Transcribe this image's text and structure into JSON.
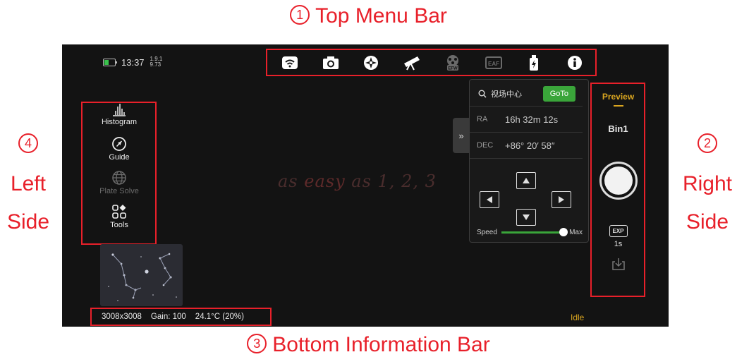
{
  "annotations": {
    "top": {
      "num": "1",
      "text": "Top Menu Bar"
    },
    "bottom": {
      "num": "3",
      "text": "Bottom Information Bar"
    },
    "left": {
      "num": "4",
      "line1": "Left",
      "line2": "Side"
    },
    "right": {
      "num": "2",
      "line1": "Right",
      "line2": "Side"
    },
    "color": "#e8202a"
  },
  "status": {
    "time": "13:37",
    "version_top": "1.9.1",
    "version_bottom": "9.73"
  },
  "topbar": {
    "icons": [
      "wifi-icon",
      "camera-icon",
      "focuser-icon",
      "telescope-icon",
      "efw-icon",
      "eaf-icon",
      "power-icon",
      "info-icon"
    ],
    "efw_label": "EFW",
    "eaf_label": "EAF"
  },
  "leftbar": {
    "items": [
      {
        "label": "Histogram",
        "icon": "histogram-icon"
      },
      {
        "label": "Guide",
        "icon": "guide-icon"
      },
      {
        "label": "Plate Solve",
        "icon": "globe-icon",
        "disabled": true
      },
      {
        "label": "Tools",
        "icon": "tools-icon"
      }
    ]
  },
  "watermark": {
    "part1": "as ",
    "part2": "easy",
    "part3": " as 1, 2, 3"
  },
  "goto_panel": {
    "search_text": "视场中心",
    "goto_label": "GoTo",
    "ra_label": "RA",
    "ra_value": "16h 32m 12s",
    "dec_label": "DEC",
    "dec_value": "+86° 20′ 58″",
    "speed_label": "Speed",
    "speed_max_label": "Max",
    "speed_value": 1.0,
    "collapse_icon": "»"
  },
  "right_panel": {
    "preview_label": "Preview",
    "bin_label": "Bin1",
    "exp_label": "EXP",
    "exp_value": "1s"
  },
  "bottom_bar": {
    "resolution": "3008x3008",
    "gain": "Gain: 100",
    "temperature": "24.1°C (20%)",
    "state": "Idle"
  },
  "colors": {
    "accent_green": "#3aa53a",
    "accent_gold": "#d9a520",
    "background": "#131313"
  }
}
